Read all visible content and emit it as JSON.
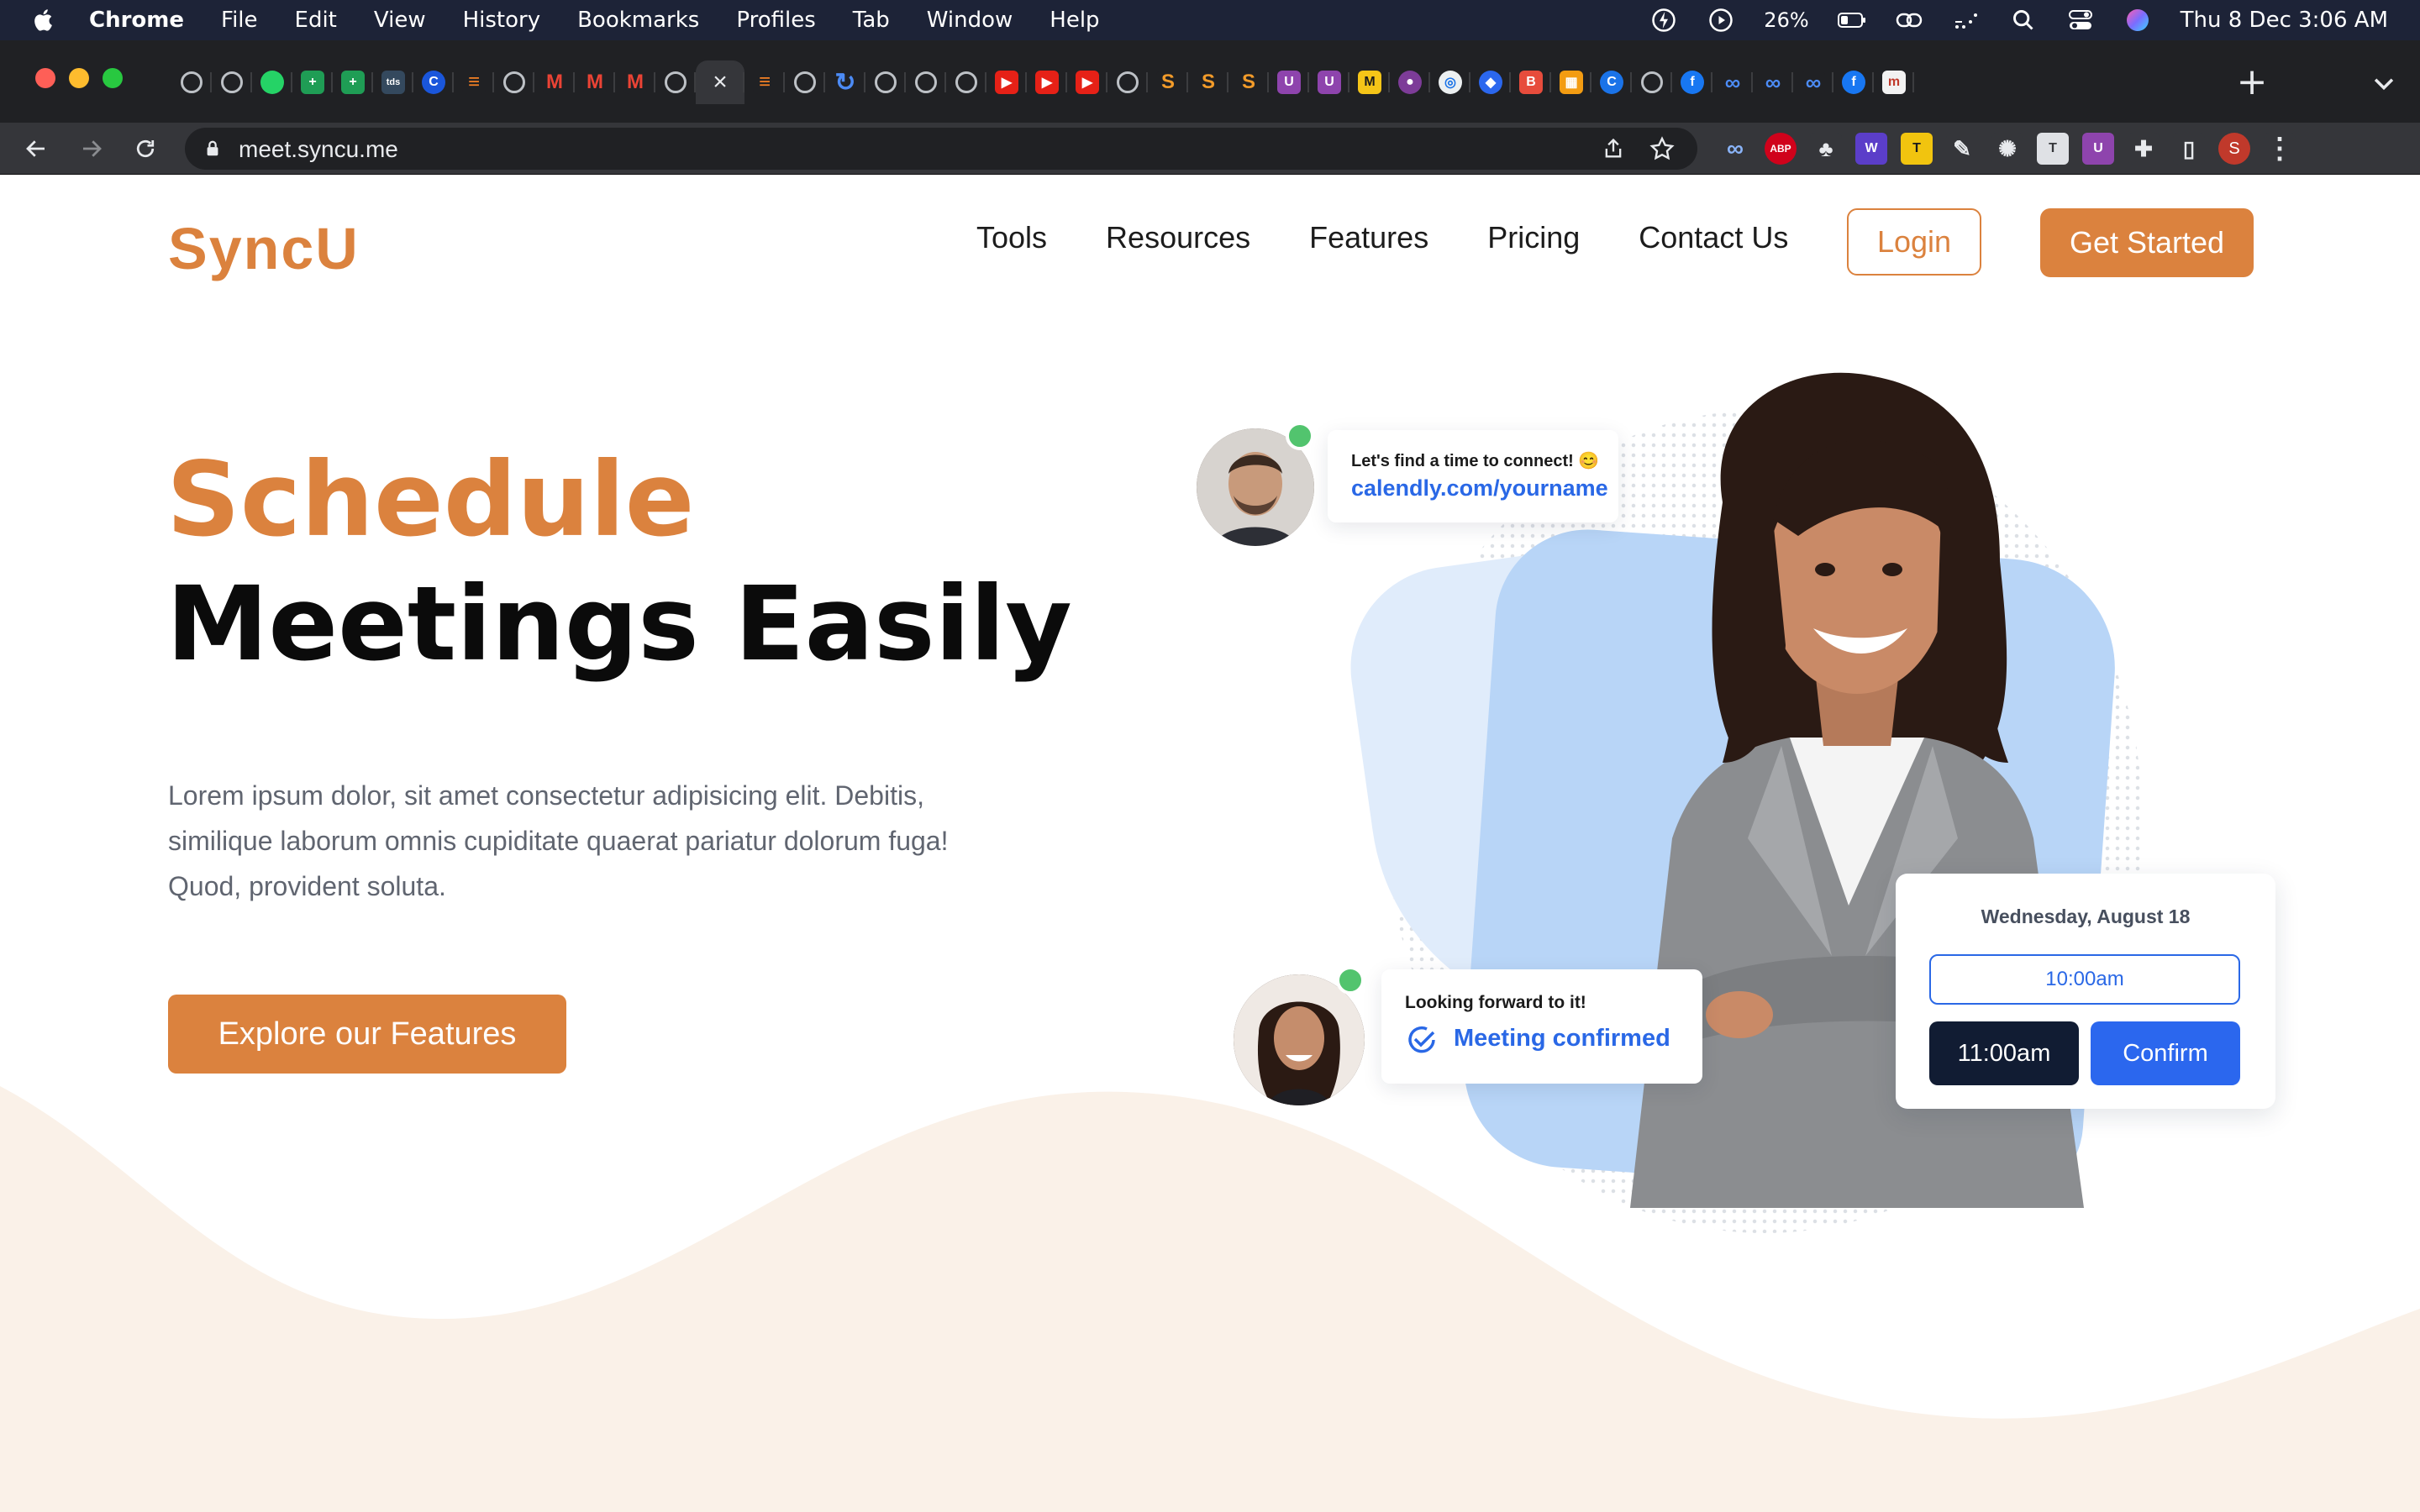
{
  "menubar": {
    "app": "Chrome",
    "items": [
      "File",
      "Edit",
      "View",
      "History",
      "Bookmarks",
      "Profiles",
      "Tab",
      "Window",
      "Help"
    ],
    "battery": "26%",
    "clock": "Thu 8 Dec  3:06 AM"
  },
  "browser": {
    "url": "meet.syncu.me",
    "tabs": [
      {
        "icon": "globe-icon",
        "color": "#5f6368",
        "glyph": ""
      },
      {
        "icon": "globe-icon",
        "color": "#5f6368",
        "glyph": ""
      },
      {
        "icon": "whatsapp-icon",
        "color": "#25d366",
        "glyph": ""
      },
      {
        "icon": "sheets-icon",
        "color": "#1f9d55",
        "glyph": "+"
      },
      {
        "icon": "sheets-icon",
        "color": "#1f9d55",
        "glyph": "+"
      },
      {
        "icon": "tds-icon",
        "color": "#34495e",
        "glyph": "tds"
      },
      {
        "icon": "c-icon",
        "color": "#1a56db",
        "glyph": "C"
      },
      {
        "icon": "stackoverflow-icon",
        "color": "#202124",
        "glyph": "≡"
      },
      {
        "icon": "globe-icon",
        "color": "#5f6368",
        "glyph": ""
      },
      {
        "icon": "gmail-icon",
        "color": "#202124",
        "glyph": "M"
      },
      {
        "icon": "gmail-icon",
        "color": "#202124",
        "glyph": "M"
      },
      {
        "icon": "gmail-icon",
        "color": "#202124",
        "glyph": "M"
      },
      {
        "icon": "globe-icon",
        "color": "#5f6368",
        "glyph": ""
      },
      {
        "icon": "close-icon",
        "color": "#35363a",
        "glyph": "×",
        "active": true
      },
      {
        "icon": "stackoverflow-icon",
        "color": "#202124",
        "glyph": "≡"
      },
      {
        "icon": "globe-icon",
        "color": "#5f6368",
        "glyph": ""
      },
      {
        "icon": "loading-icon",
        "color": "#1a73e8",
        "glyph": "↻"
      },
      {
        "icon": "globe-icon",
        "color": "#5f6368",
        "glyph": ""
      },
      {
        "icon": "globe-icon",
        "color": "#5f6368",
        "glyph": ""
      },
      {
        "icon": "globe-icon",
        "color": "#5f6368",
        "glyph": ""
      },
      {
        "icon": "youtube-icon",
        "color": "#e62117",
        "glyph": "▶"
      },
      {
        "icon": "youtube-icon",
        "color": "#e62117",
        "glyph": "▶"
      },
      {
        "icon": "youtube-icon",
        "color": "#e62117",
        "glyph": "▶"
      },
      {
        "icon": "globe-icon",
        "color": "#5f6368",
        "glyph": ""
      },
      {
        "icon": "s-icon",
        "color": "#202124",
        "glyph": "S"
      },
      {
        "icon": "s-icon",
        "color": "#202124",
        "glyph": "S"
      },
      {
        "icon": "s-icon",
        "color": "#202124",
        "glyph": "S"
      },
      {
        "icon": "u-icon",
        "color": "#8e44ad",
        "glyph": "U"
      },
      {
        "icon": "u-icon",
        "color": "#8e44ad",
        "glyph": "U"
      },
      {
        "icon": "miro-icon",
        "color": "#f5c518",
        "glyph": "M"
      },
      {
        "icon": "drop-icon",
        "color": "#7d3c98",
        "glyph": "●"
      },
      {
        "icon": "target-icon",
        "color": "#ecf0f1",
        "glyph": "◎"
      },
      {
        "icon": "bird-icon",
        "color": "#2b67ee",
        "glyph": "◆"
      },
      {
        "icon": "b-icon",
        "color": "#e74c3c",
        "glyph": "B"
      },
      {
        "icon": "grid-icon",
        "color": "#f39c12",
        "glyph": "▦"
      },
      {
        "icon": "c-icon",
        "color": "#1a73e8",
        "glyph": "C"
      },
      {
        "icon": "globe-icon",
        "color": "#5f6368",
        "glyph": ""
      },
      {
        "icon": "facebook-icon",
        "color": "#1877f2",
        "glyph": "f"
      },
      {
        "icon": "meta-icon",
        "color": "#202124",
        "glyph": "∞"
      },
      {
        "icon": "meta-icon",
        "color": "#202124",
        "glyph": "∞"
      },
      {
        "icon": "meta-icon",
        "color": "#202124",
        "glyph": "∞"
      },
      {
        "icon": "facebook-icon",
        "color": "#1877f2",
        "glyph": "f"
      },
      {
        "icon": "m-icon",
        "color": "#f2f2f2",
        "glyph": "m"
      }
    ],
    "extensions": [
      {
        "name": "cloud-ext-icon",
        "color": "#3b5998",
        "glyph": "∞"
      },
      {
        "name": "adblock-ext-icon",
        "color": "#d0021b",
        "glyph": "ABP"
      },
      {
        "name": "leaf-ext-icon",
        "color": "#35363a",
        "glyph": "♣"
      },
      {
        "name": "w-ext-icon",
        "color": "#5b3ec9",
        "glyph": "W"
      },
      {
        "name": "t-ext-icon",
        "color": "#f1c40f",
        "glyph": "T"
      },
      {
        "name": "pen-ext-icon",
        "color": "#35363a",
        "glyph": "✎"
      },
      {
        "name": "openai-ext-icon",
        "color": "#35363a",
        "glyph": "✺"
      },
      {
        "name": "doc-ext-icon",
        "color": "#dfe1e5",
        "glyph": "T"
      },
      {
        "name": "u-ext-icon",
        "color": "#8e44ad",
        "glyph": "U"
      },
      {
        "name": "puzzle-ext-icon",
        "color": "#35363a",
        "glyph": "✚"
      },
      {
        "name": "sidepanel-icon",
        "color": "#35363a",
        "glyph": "▯"
      },
      {
        "name": "profile-avatar",
        "color": "#c0392b",
        "glyph": "S"
      },
      {
        "name": "kebab-menu-icon",
        "color": "#35363a",
        "glyph": "⋮"
      }
    ]
  },
  "site": {
    "logo": "SyncU",
    "nav": [
      "Tools",
      "Resources",
      "Features",
      "Pricing",
      "Contact Us"
    ],
    "login": "Login",
    "get_started": "Get Started",
    "hero": {
      "title_accent": "Schedule",
      "title_main": "Meetings Easily",
      "description": "Lorem ipsum dolor, sit amet consectetur adipisicing elit. Debitis, similique laborum omnis cupiditate quaerat pariatur dolorum fuga! Quod, provident soluta.",
      "cta": "Explore our Features"
    },
    "illustration": {
      "chat1_text": "Let's find a time to connect! 😊",
      "chat1_link": "calendly.com/yourname",
      "chat2_text": "Looking forward to it!",
      "chat2_status": "Meeting confirmed",
      "picker_date": "Wednesday, August 18",
      "slot1": "10:00am",
      "slot2": "11:00am",
      "confirm": "Confirm"
    },
    "colors": {
      "accent": "#db823e",
      "link_blue": "#2a68e6",
      "wave": "#faf1e8"
    }
  }
}
